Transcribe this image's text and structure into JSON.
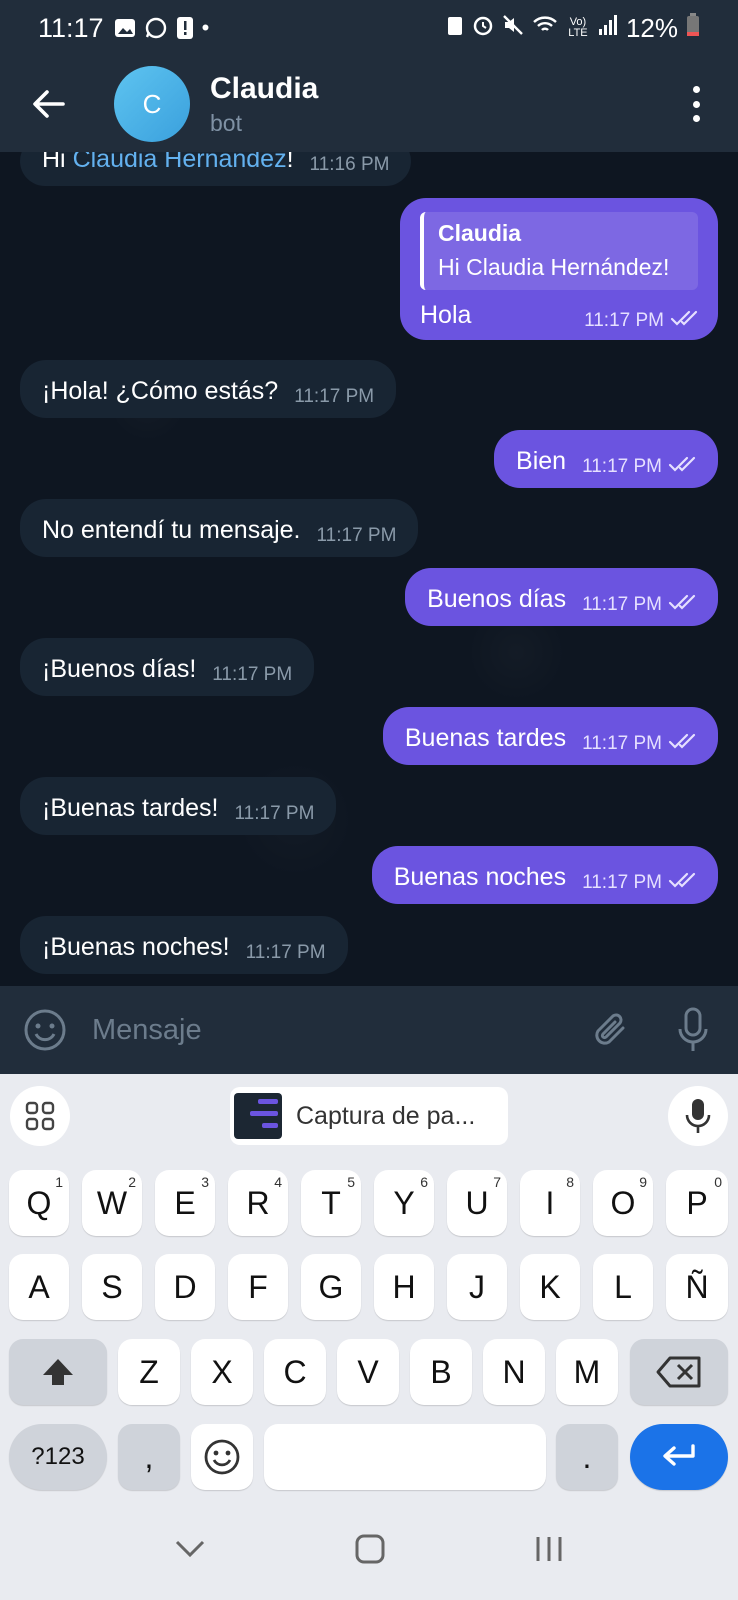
{
  "status": {
    "time": "11:17",
    "battery": "12%",
    "volte": "Vo) LTE"
  },
  "header": {
    "name": "Claudia",
    "subtitle": "bot",
    "avatar_letter": "C"
  },
  "messages": [
    {
      "dir": "in",
      "text_before": "Hi ",
      "link": "Claudia Hernández",
      "text_after": "!",
      "time": "11:16 PM"
    },
    {
      "dir": "out",
      "reply_name": "Claudia",
      "reply_text": "Hi Claudia Hernández!",
      "text": "Hola",
      "time": "11:17 PM"
    },
    {
      "dir": "in",
      "text": "¡Hola! ¿Cómo estás?",
      "time": "11:17 PM"
    },
    {
      "dir": "out",
      "text": "Bien",
      "time": "11:17 PM"
    },
    {
      "dir": "in",
      "text": "No entendí tu mensaje.",
      "time": "11:17 PM"
    },
    {
      "dir": "out",
      "text": "Buenos días",
      "time": "11:17 PM"
    },
    {
      "dir": "in",
      "text": "¡Buenos días!",
      "time": "11:17 PM"
    },
    {
      "dir": "out",
      "text": "Buenas tardes",
      "time": "11:17 PM"
    },
    {
      "dir": "in",
      "text": "¡Buenas tardes!",
      "time": "11:17 PM"
    },
    {
      "dir": "out",
      "text": "Buenas noches",
      "time": "11:17 PM"
    },
    {
      "dir": "in",
      "text": "¡Buenas noches!",
      "time": "11:17 PM"
    }
  ],
  "input": {
    "placeholder": "Mensaje"
  },
  "keyboard": {
    "suggestion": "Captura de pa...",
    "row1": [
      "Q",
      "W",
      "E",
      "R",
      "T",
      "Y",
      "U",
      "I",
      "O",
      "P"
    ],
    "row1_nums": [
      "1",
      "2",
      "3",
      "4",
      "5",
      "6",
      "7",
      "8",
      "9",
      "0"
    ],
    "row2": [
      "A",
      "S",
      "D",
      "F",
      "G",
      "H",
      "J",
      "K",
      "L",
      "Ñ"
    ],
    "row3": [
      "Z",
      "X",
      "C",
      "V",
      "B",
      "N",
      "M"
    ],
    "sym": "?123",
    "comma": ",",
    "period": "."
  },
  "colors": {
    "outgoing": "#6b54e0",
    "incoming": "#182533",
    "link": "#63b1ef",
    "enter": "#1b73e8"
  }
}
